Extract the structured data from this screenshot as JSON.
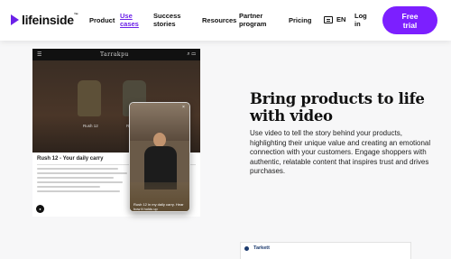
{
  "brand": {
    "name": "lifeinside",
    "tm": "™"
  },
  "nav": {
    "items": [
      {
        "label": "Product"
      },
      {
        "label": "Use cases"
      },
      {
        "label": "Success stories"
      },
      {
        "label": "Resources"
      },
      {
        "label": "Partner program"
      },
      {
        "label": "Pricing"
      }
    ],
    "language": "EN",
    "login": "Log in",
    "cta": "Free trial"
  },
  "shop_preview": {
    "store_name": "Tarrakpu",
    "products": [
      "Rush 12",
      "Rush 24"
    ],
    "detail_title": "Rush 12 - Your daily carry",
    "video_caption": "Rush 12 in my daily carry. Hear how it holds up"
  },
  "hero": {
    "headline": "Bring products to life with video",
    "body": "Use video to tell the story behind your products, highlighting their unique value and creating an emotional connection with your customers. Engage shoppers with authentic, relatable content that inspires trust and drives purchases."
  },
  "next_preview": {
    "brand": "Tarkett"
  },
  "colors": {
    "accent": "#7c1fff",
    "text": "#111111",
    "background": "#f7f7f8"
  }
}
